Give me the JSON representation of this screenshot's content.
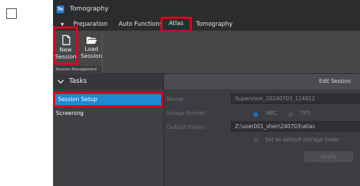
{
  "app": {
    "logo": "To",
    "title": "Tomography"
  },
  "menu": {
    "items": [
      "Preparation",
      "Auto Functions",
      "Atlas",
      "Tomography"
    ],
    "selected": "Atlas"
  },
  "ribbon": {
    "new_session": "New Session",
    "load_session": "Load Session",
    "group_label": "Session Management"
  },
  "tasks": {
    "title": "Tasks",
    "items": [
      "Session Setup",
      "Screening"
    ],
    "selected": "Session Setup"
  },
  "edit": {
    "title": "Edit Session",
    "name_label": "Name:",
    "name_value": "Supervisor_20240703_124812",
    "format_label": "Image format:",
    "format_options": [
      "MRC",
      "TIFF"
    ],
    "format_selected": "MRC",
    "output_label": "Output folder:",
    "output_value": "Z:\\user001_shen\\240703\\atlas",
    "default_checkbox_label": "Set as default storage folder",
    "apply_label": "Apply"
  },
  "colors": {
    "highlight": "#e3001b",
    "accent": "#1f7fd4",
    "selection": "#1e8ad2"
  }
}
